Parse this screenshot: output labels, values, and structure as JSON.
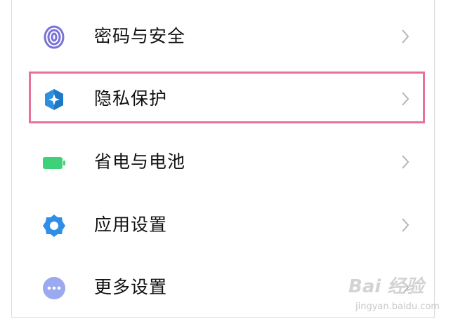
{
  "settings": {
    "items": [
      {
        "label": "密码与安全",
        "icon": "fingerprint-icon",
        "icon_color": "#7a72d8"
      },
      {
        "label": "隐私保护",
        "icon": "privacy-shield-icon",
        "icon_color": "#2c8fdf"
      },
      {
        "label": "省电与电池",
        "icon": "battery-icon",
        "icon_color": "#3fd17a"
      },
      {
        "label": "应用设置",
        "icon": "gear-icon",
        "icon_color": "#2e8ee8"
      },
      {
        "label": "更多设置",
        "icon": "more-dots-icon",
        "icon_color": "#9ba9f0"
      }
    ],
    "highlighted_index": 1,
    "highlight_color": "#e8709a"
  },
  "watermark": {
    "brand": "Bai 经验",
    "url": "jingyan.baidu.com"
  }
}
